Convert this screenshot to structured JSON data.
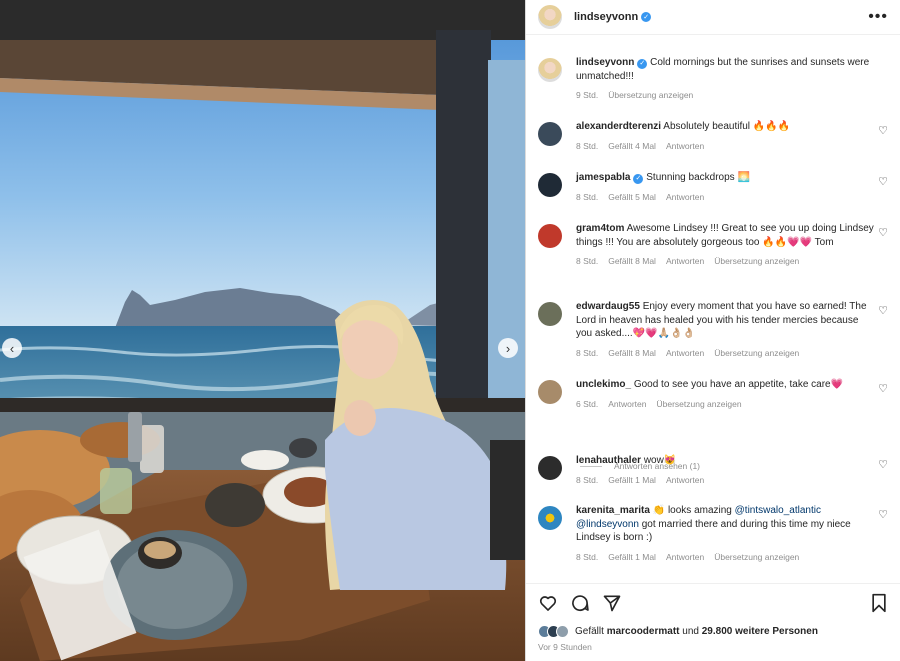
{
  "post": {
    "username": "lindseyvonn",
    "more_label": "•••",
    "caption_text": "Cold mornings but the sunrises and sunsets were unmatched!!!",
    "caption_time": "9 Std.",
    "caption_translate": "Übersetzung anzeigen"
  },
  "photo": {
    "prev_label": "‹",
    "next_label": "›"
  },
  "comments": [
    {
      "user": "alexanderdterenzi",
      "text": "Absolutely beautiful 🔥🔥🔥",
      "time": "8 Std.",
      "likes": "Gefällt 4 Mal",
      "reply": "Antworten",
      "translate": ""
    },
    {
      "user": "jamespabla",
      "text": "Stunning backdrops 🌅",
      "time": "8 Std.",
      "likes": "Gefällt 5 Mal",
      "reply": "Antworten",
      "translate": ""
    },
    {
      "user": "gram4tom",
      "text": "Awesome Lindsey !!! Great to see you up doing Lindsey things !!! You are absolutely gorgeous too 🔥🔥💗💗 Tom",
      "time": "8 Std.",
      "likes": "Gefällt 8 Mal",
      "reply": "Antworten",
      "translate": "Übersetzung anzeigen"
    },
    {
      "user": "edwardaug55",
      "text": "Enjoy every moment that you have so earned! The Lord in heaven has healed you with his tender mercies because you asked....💖💗🙏🏼👌🏼👌🏼",
      "time": "8 Std.",
      "likes": "Gefällt 8 Mal",
      "reply": "Antworten",
      "translate": "Übersetzung anzeigen"
    },
    {
      "user": "unclekimo_",
      "text": "Good to see you have an appetite, take care💗",
      "time": "6 Std.",
      "likes": "",
      "reply": "Antworten",
      "translate": "Übersetzung anzeigen"
    },
    {
      "user": "lenahauthaler",
      "text": "wow😻",
      "time": "8 Std.",
      "likes": "Gefällt 1 Mal",
      "reply": "Antworten",
      "translate": ""
    },
    {
      "user": "karenita_marita",
      "text_pre": "👏 looks amazing ",
      "mention1": "@tintswalo_atlantic",
      "mention2": "@lindseyvonn",
      "text_post": " got married there and during this time my niece Lindsey is born :)",
      "time": "8 Std.",
      "likes": "Gefällt 1 Mal",
      "reply": "Antworten",
      "translate": "Übersetzung anzeigen"
    }
  ],
  "view_replies": "Antworten ansehen (1)",
  "footer": {
    "liked_by_prefix": "Gefällt",
    "liked_by_user": "marcoodermatt",
    "liked_by_mid": "und",
    "liked_by_count": "29.800 weitere Personen",
    "posted_ago": "Vor 9 Stunden"
  },
  "icons": {
    "heart": "heart-icon",
    "comment": "comment-icon",
    "share": "share-icon",
    "bookmark": "bookmark-icon",
    "verified": "verified-badge-icon"
  },
  "colors": {
    "link": "#00376b",
    "verified": "#3897f0",
    "meta_gray": "#8e8e8e"
  }
}
